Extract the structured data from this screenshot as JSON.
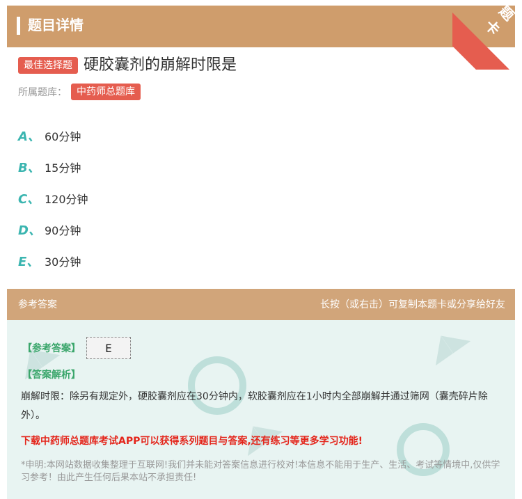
{
  "header": {
    "title": "题目详情"
  },
  "corner_ribbon": {
    "text": "题卡"
  },
  "question": {
    "type_badge": "最佳选择题",
    "text": "硬胶囊剂的崩解时限是",
    "bank_label": "所属题库：",
    "bank_name": "中药师总题库"
  },
  "options": [
    {
      "letter": "A、",
      "text": "60分钟"
    },
    {
      "letter": "B、",
      "text": "15分钟"
    },
    {
      "letter": "C、",
      "text": "120分钟"
    },
    {
      "letter": "D、",
      "text": "90分钟"
    },
    {
      "letter": "E、",
      "text": "30分钟"
    }
  ],
  "answer_section": {
    "title": "参考答案",
    "hint": "长按（或右击）可复制本题卡或分享给好友",
    "answer_label": "【参考答案】",
    "answer_value": "E",
    "analysis_label": "【答案解析】",
    "analysis_text": "崩解时限：除另有规定外，硬胶囊剂应在30分钟内，软胶囊剂应在1小时内全部崩解并通过筛网（囊壳碎片除外）。",
    "download_text": "下载中药师总题库考试APP可以获得系列题目与答案,还有练习等更多学习功能!",
    "disclaimer": "*申明:本网站数据收集整理于互联网!我们并未能对答案信息进行校对!本信息不能用于生产、生活、考试等情境中,仅供学习参考！由此产生任何后果本站不承担责任!"
  },
  "colors": {
    "header_bg": "#cf9d6c",
    "answer_header_bg": "#d1a57a",
    "badge_red": "#e55d4f",
    "option_letter": "#3bb5b0",
    "answer_green": "#3aa66b",
    "download_red": "#e4251b",
    "panel_bg": "#e8f4f2"
  }
}
